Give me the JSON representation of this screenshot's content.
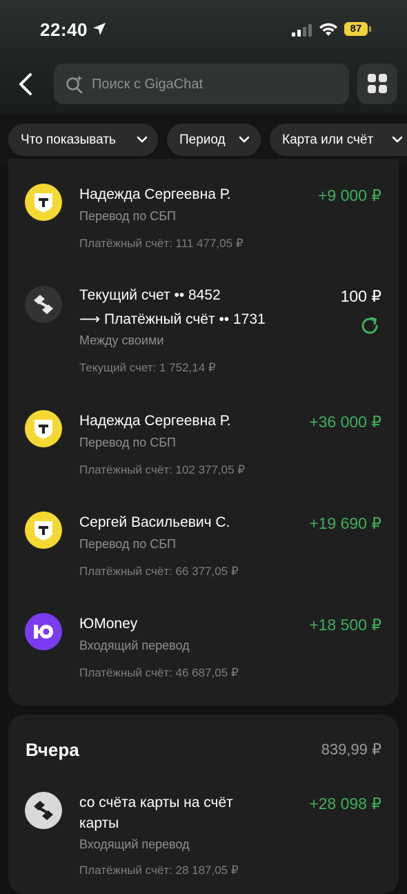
{
  "status_bar": {
    "time": "22:40",
    "battery": "87"
  },
  "header": {
    "search_placeholder": "Поиск с GigaChat"
  },
  "filters": [
    {
      "label": "Что показывать"
    },
    {
      "label": "Период"
    },
    {
      "label": "Карта или счёт"
    }
  ],
  "transactions": [
    {
      "title": "Надежда Сергеевна Р.",
      "subtitle": "Перевод по СБП",
      "balance": "Платёжный счёт: 111 477,05 ₽",
      "amount": "+9 000 ₽",
      "icon": "tbank-logo"
    },
    {
      "title": "Текущий счет •• 8452",
      "title2": "⟶ Платёжный счёт •• 1731",
      "subtitle": "Между своими",
      "balance": "Текущий счет: 1 752,14 ₽",
      "amount": "100 ₽",
      "icon": "transfer-arrows-icon"
    },
    {
      "title": "Надежда Сергеевна Р.",
      "subtitle": "Перевод по СБП",
      "balance": "Платёжный счёт: 102 377,05 ₽",
      "amount": "+36 000 ₽",
      "icon": "tbank-logo"
    },
    {
      "title": "Сергей Васильевич С.",
      "subtitle": "Перевод по СБП",
      "balance": "Платёжный счёт: 66 377,05 ₽",
      "amount": "+19 690 ₽",
      "icon": "tbank-logo"
    },
    {
      "title": "ЮMoney",
      "subtitle": "Входящий перевод",
      "balance": "Платёжный счёт: 46 687,05 ₽",
      "amount": "+18 500 ₽",
      "icon": "yoomoney-logo"
    }
  ],
  "yesterday": {
    "title": "Вчера",
    "total": "839,99 ₽",
    "transactions": [
      {
        "title": "со счёта карты на счёт",
        "title2": "карты",
        "subtitle": "Входящий перевод",
        "balance": "Платёжный счёт: 28 187,05 ₽",
        "amount": "+28 098 ₽",
        "icon": "transfer-arrows-icon"
      }
    ]
  },
  "colors": {
    "income": "#3fae5a",
    "tbank_yellow": "#f5d933",
    "yoomoney_purple": "#7b3cf0",
    "battery": "#f0d33a"
  }
}
